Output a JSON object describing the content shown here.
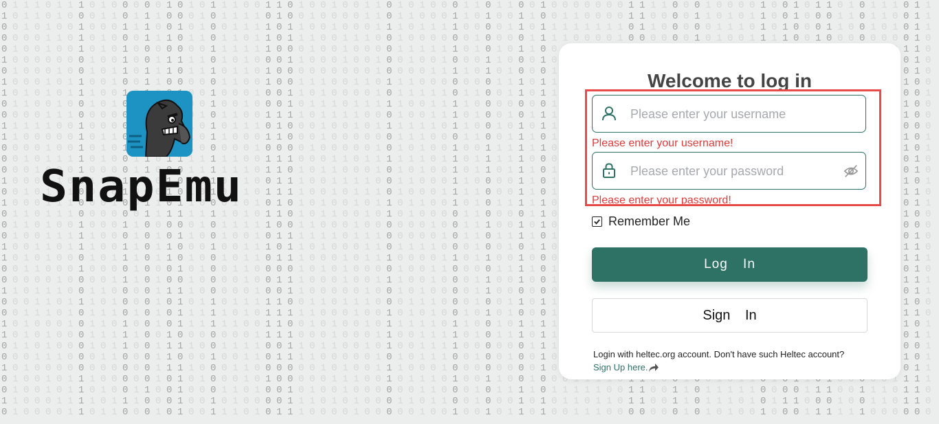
{
  "brand": {
    "name": "SnapEmu",
    "logo_icon": "snapemu-bird-icon",
    "logo_bg": "#1d93c4"
  },
  "login": {
    "title": "Welcome to log in",
    "username": {
      "placeholder": "Please enter your username",
      "value": "",
      "icon": "user-icon",
      "error": "Please enter your username!"
    },
    "password": {
      "placeholder": "Please enter your password",
      "value": "",
      "icon": "lock-icon",
      "toggle_icon": "eye-off-icon",
      "error": "Please enter your password!"
    },
    "remember_me": {
      "label": "Remember Me",
      "checked": true
    },
    "login_button": "Log In",
    "signin_button": "Sign In",
    "footer_text": "Login with heltec.org account. Don't have such Heltec account?",
    "footer_link": "Sign Up here.",
    "footer_link_icon": "share-arrow-icon"
  },
  "colors": {
    "accent": "#2e7265",
    "error": "#e23a3a",
    "highlight_border": "#e84a4a",
    "background": "#eceded"
  }
}
